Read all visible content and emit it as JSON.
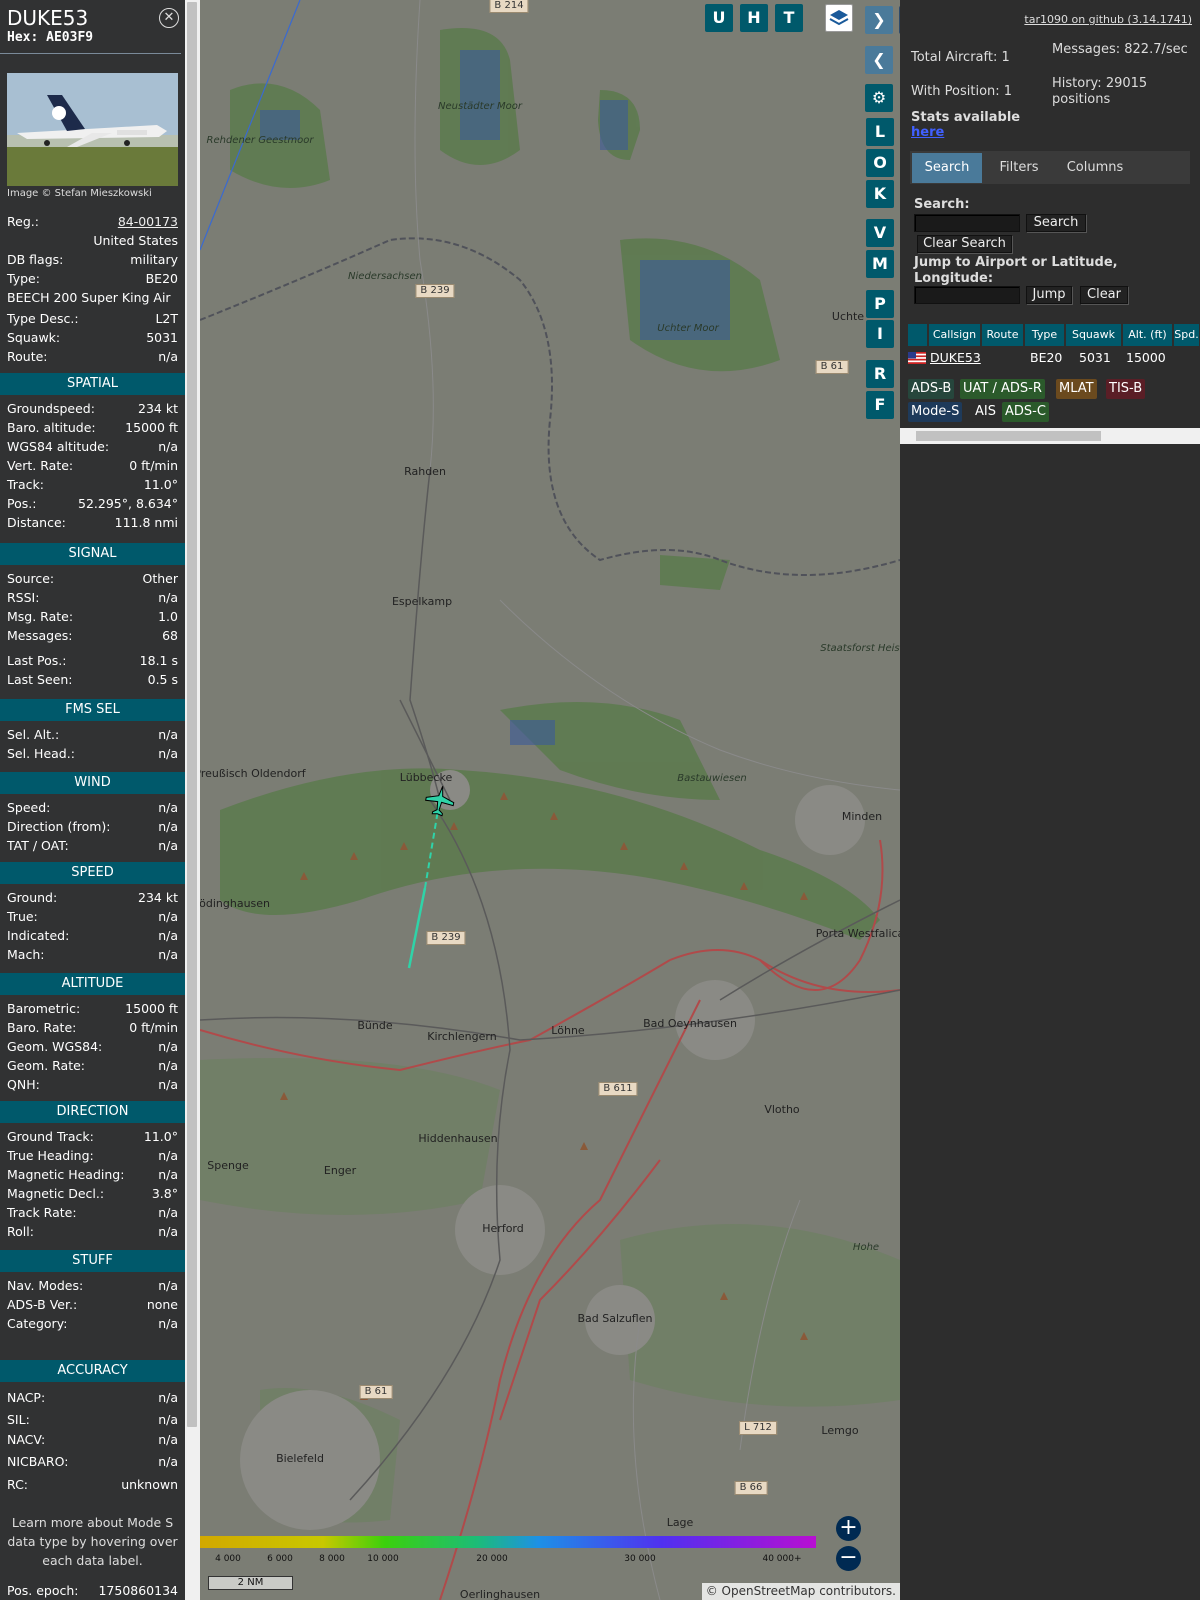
{
  "aircraft": {
    "callsign": "DUKE53",
    "hex_label": "Hex: AE03F9",
    "photo_credit": "Image © Stefan Mieszkowski",
    "details": [
      {
        "key": "Reg.:",
        "value": "84-00173"
      },
      {
        "key": "",
        "value": "United States"
      },
      {
        "key": "DB flags:",
        "value": "military"
      },
      {
        "key": "Type:",
        "value": "BE20"
      },
      {
        "key": "BEECH 200 Super King Air",
        "value": ""
      },
      {
        "key": "Type Desc.:",
        "value": "L2T"
      },
      {
        "key": "Squawk:",
        "value": "5031"
      },
      {
        "key": "Route:",
        "value": "n/a"
      }
    ],
    "sections": [
      {
        "title": "SPATIAL",
        "rows": [
          {
            "key": "Groundspeed:",
            "value": "234 kt"
          },
          {
            "key": "Baro. altitude:",
            "value": "15000 ft"
          },
          {
            "key": "WGS84 altitude:",
            "value": "n/a"
          },
          {
            "key": "Vert. Rate:",
            "value": "0 ft/min"
          },
          {
            "key": "Track:",
            "value": "11.0°"
          },
          {
            "key": "Pos.:",
            "value": "52.295°, 8.634°"
          },
          {
            "key": "Distance:",
            "value": "111.8 nmi"
          }
        ]
      },
      {
        "title": "SIGNAL",
        "rows": [
          {
            "key": "Source:",
            "value": "Other"
          },
          {
            "key": "RSSI:",
            "value": "n/a"
          },
          {
            "key": "Msg. Rate:",
            "value": "1.0"
          },
          {
            "key": "Messages:",
            "value": "68"
          },
          {
            "key": "Last Pos.:",
            "value": "18.1 s"
          },
          {
            "key": "Last Seen:",
            "value": "0.5 s"
          }
        ]
      },
      {
        "title": "FMS SEL",
        "rows": [
          {
            "key": "Sel. Alt.:",
            "value": "n/a"
          },
          {
            "key": "Sel. Head.:",
            "value": "n/a"
          }
        ]
      },
      {
        "title": "WIND",
        "rows": [
          {
            "key": "Speed:",
            "value": "n/a"
          },
          {
            "key": "Direction (from):",
            "value": "n/a"
          },
          {
            "key": "TAT / OAT:",
            "value": "n/a"
          }
        ]
      },
      {
        "title": "SPEED",
        "rows": [
          {
            "key": "Ground:",
            "value": "234 kt"
          },
          {
            "key": "True:",
            "value": "n/a"
          },
          {
            "key": "Indicated:",
            "value": "n/a"
          },
          {
            "key": "Mach:",
            "value": "n/a"
          }
        ]
      },
      {
        "title": "ALTITUDE",
        "rows": [
          {
            "key": "Barometric:",
            "value": "15000 ft"
          },
          {
            "key": "Baro. Rate:",
            "value": "0 ft/min"
          },
          {
            "key": "Geom. WGS84:",
            "value": "n/a"
          },
          {
            "key": "Geom. Rate:",
            "value": "n/a"
          },
          {
            "key": "QNH:",
            "value": "n/a"
          }
        ]
      },
      {
        "title": "DIRECTION",
        "rows": [
          {
            "key": "Ground Track:",
            "value": "11.0°"
          },
          {
            "key": "True Heading:",
            "value": "n/a"
          },
          {
            "key": "Magnetic Heading:",
            "value": "n/a"
          },
          {
            "key": "Magnetic Decl.:",
            "value": "3.8°"
          },
          {
            "key": "Track Rate:",
            "value": "n/a"
          },
          {
            "key": "Roll:",
            "value": "n/a"
          }
        ]
      },
      {
        "title": "STUFF",
        "rows": [
          {
            "key": "Nav. Modes:",
            "value": "n/a"
          },
          {
            "key": "ADS-B Ver.:",
            "value": "none"
          },
          {
            "key": "Category:",
            "value": "n/a"
          }
        ]
      },
      {
        "title": "ACCURACY",
        "rows": [
          {
            "key": "NACP:",
            "value": "n/a"
          },
          {
            "key": "SIL:",
            "value": "n/a"
          },
          {
            "key": "NACV:",
            "value": "n/a"
          },
          {
            "key": "NICBARO:",
            "value": "n/a"
          },
          {
            "key": "RC:",
            "value": "unknown"
          }
        ]
      }
    ],
    "learn_more": "Learn more about Mode S data type by hovering over each data label.",
    "pos_epoch_label": "Pos. epoch:",
    "pos_epoch_value": "1750860134"
  },
  "map": {
    "buttons": [
      "U",
      "H",
      "T"
    ],
    "side_buttons": [
      "L",
      "O",
      "K",
      "V",
      "M",
      "P",
      "I",
      "R",
      "F"
    ],
    "places": [
      "Rahden",
      "Espelkamp",
      "Lübbecke",
      "Preußisch Oldendorf",
      "Minden",
      "Porta Westfalica",
      "Bünde",
      "Kirchlengern",
      "Löhne",
      "Bad Oeynhausen",
      "Vlotho",
      "Hiddenhausen",
      "Spenge",
      "Enger",
      "Herford",
      "Bad Salzuflen",
      "Bielefeld",
      "Lemgo",
      "Lage",
      "Oerlinghausen",
      "Uchte",
      "Rödinghausen",
      "Neustädter Moor",
      "Uchter Moor",
      "Rehdener Geestmoor",
      "Bastauwiesen",
      "Niedersachsen",
      "Staatsforst Heister",
      "Hohe"
    ],
    "roads": [
      "B 214",
      "B 239",
      "B 61",
      "B 239",
      "B 611",
      "B 61",
      "L 712",
      "B 66"
    ],
    "colorbar_ticks": [
      "4 000",
      "6 000",
      "8 000",
      "10 000",
      "20 000",
      "30 000",
      "40 000+"
    ],
    "scale_label": "2 NM",
    "attribution": "© OpenStreetMap contributors.",
    "zoom_in": "+",
    "zoom_out": "−"
  },
  "side": {
    "github": "tar1090 on github (3.14.1741)",
    "total_aircraft": "Total Aircraft: 1",
    "with_position": "With Position: 1",
    "messages": "Messages: 822.7/sec",
    "history": "History: 29015 positions",
    "stats_text": "Stats available",
    "stats_link": "here",
    "tabs": [
      "Search",
      "Filters",
      "Columns"
    ],
    "search_label": "Search:",
    "search_button": "Search",
    "clear_search_button": "Clear Search",
    "jump_label": "Jump to Airport or Latitude, Longitude:",
    "jump_button": "Jump",
    "clear_button": "Clear",
    "table_headers": [
      "",
      "Callsign",
      "Route",
      "Type",
      "Squawk",
      "Alt. (ft)",
      "Spd."
    ],
    "table_row": {
      "callsign": "DUKE53",
      "route": "",
      "type": "BE20",
      "squawk": "5031",
      "alt": "15000"
    },
    "tags": [
      {
        "label": "ADS-B",
        "color": "#26463c"
      },
      {
        "label": "UAT / ADS-R",
        "color": "#2b5a2b"
      },
      {
        "label": "MLAT",
        "color": "#6b4a1e"
      },
      {
        "label": "TIS-B",
        "color": "#5a1e26"
      },
      {
        "label": "Mode-S",
        "color": "#1e3a5a"
      },
      {
        "label": "AIS",
        "color": "#2d2d2d"
      },
      {
        "label": "ADS-C",
        "color": "#2b5a2b"
      }
    ]
  }
}
